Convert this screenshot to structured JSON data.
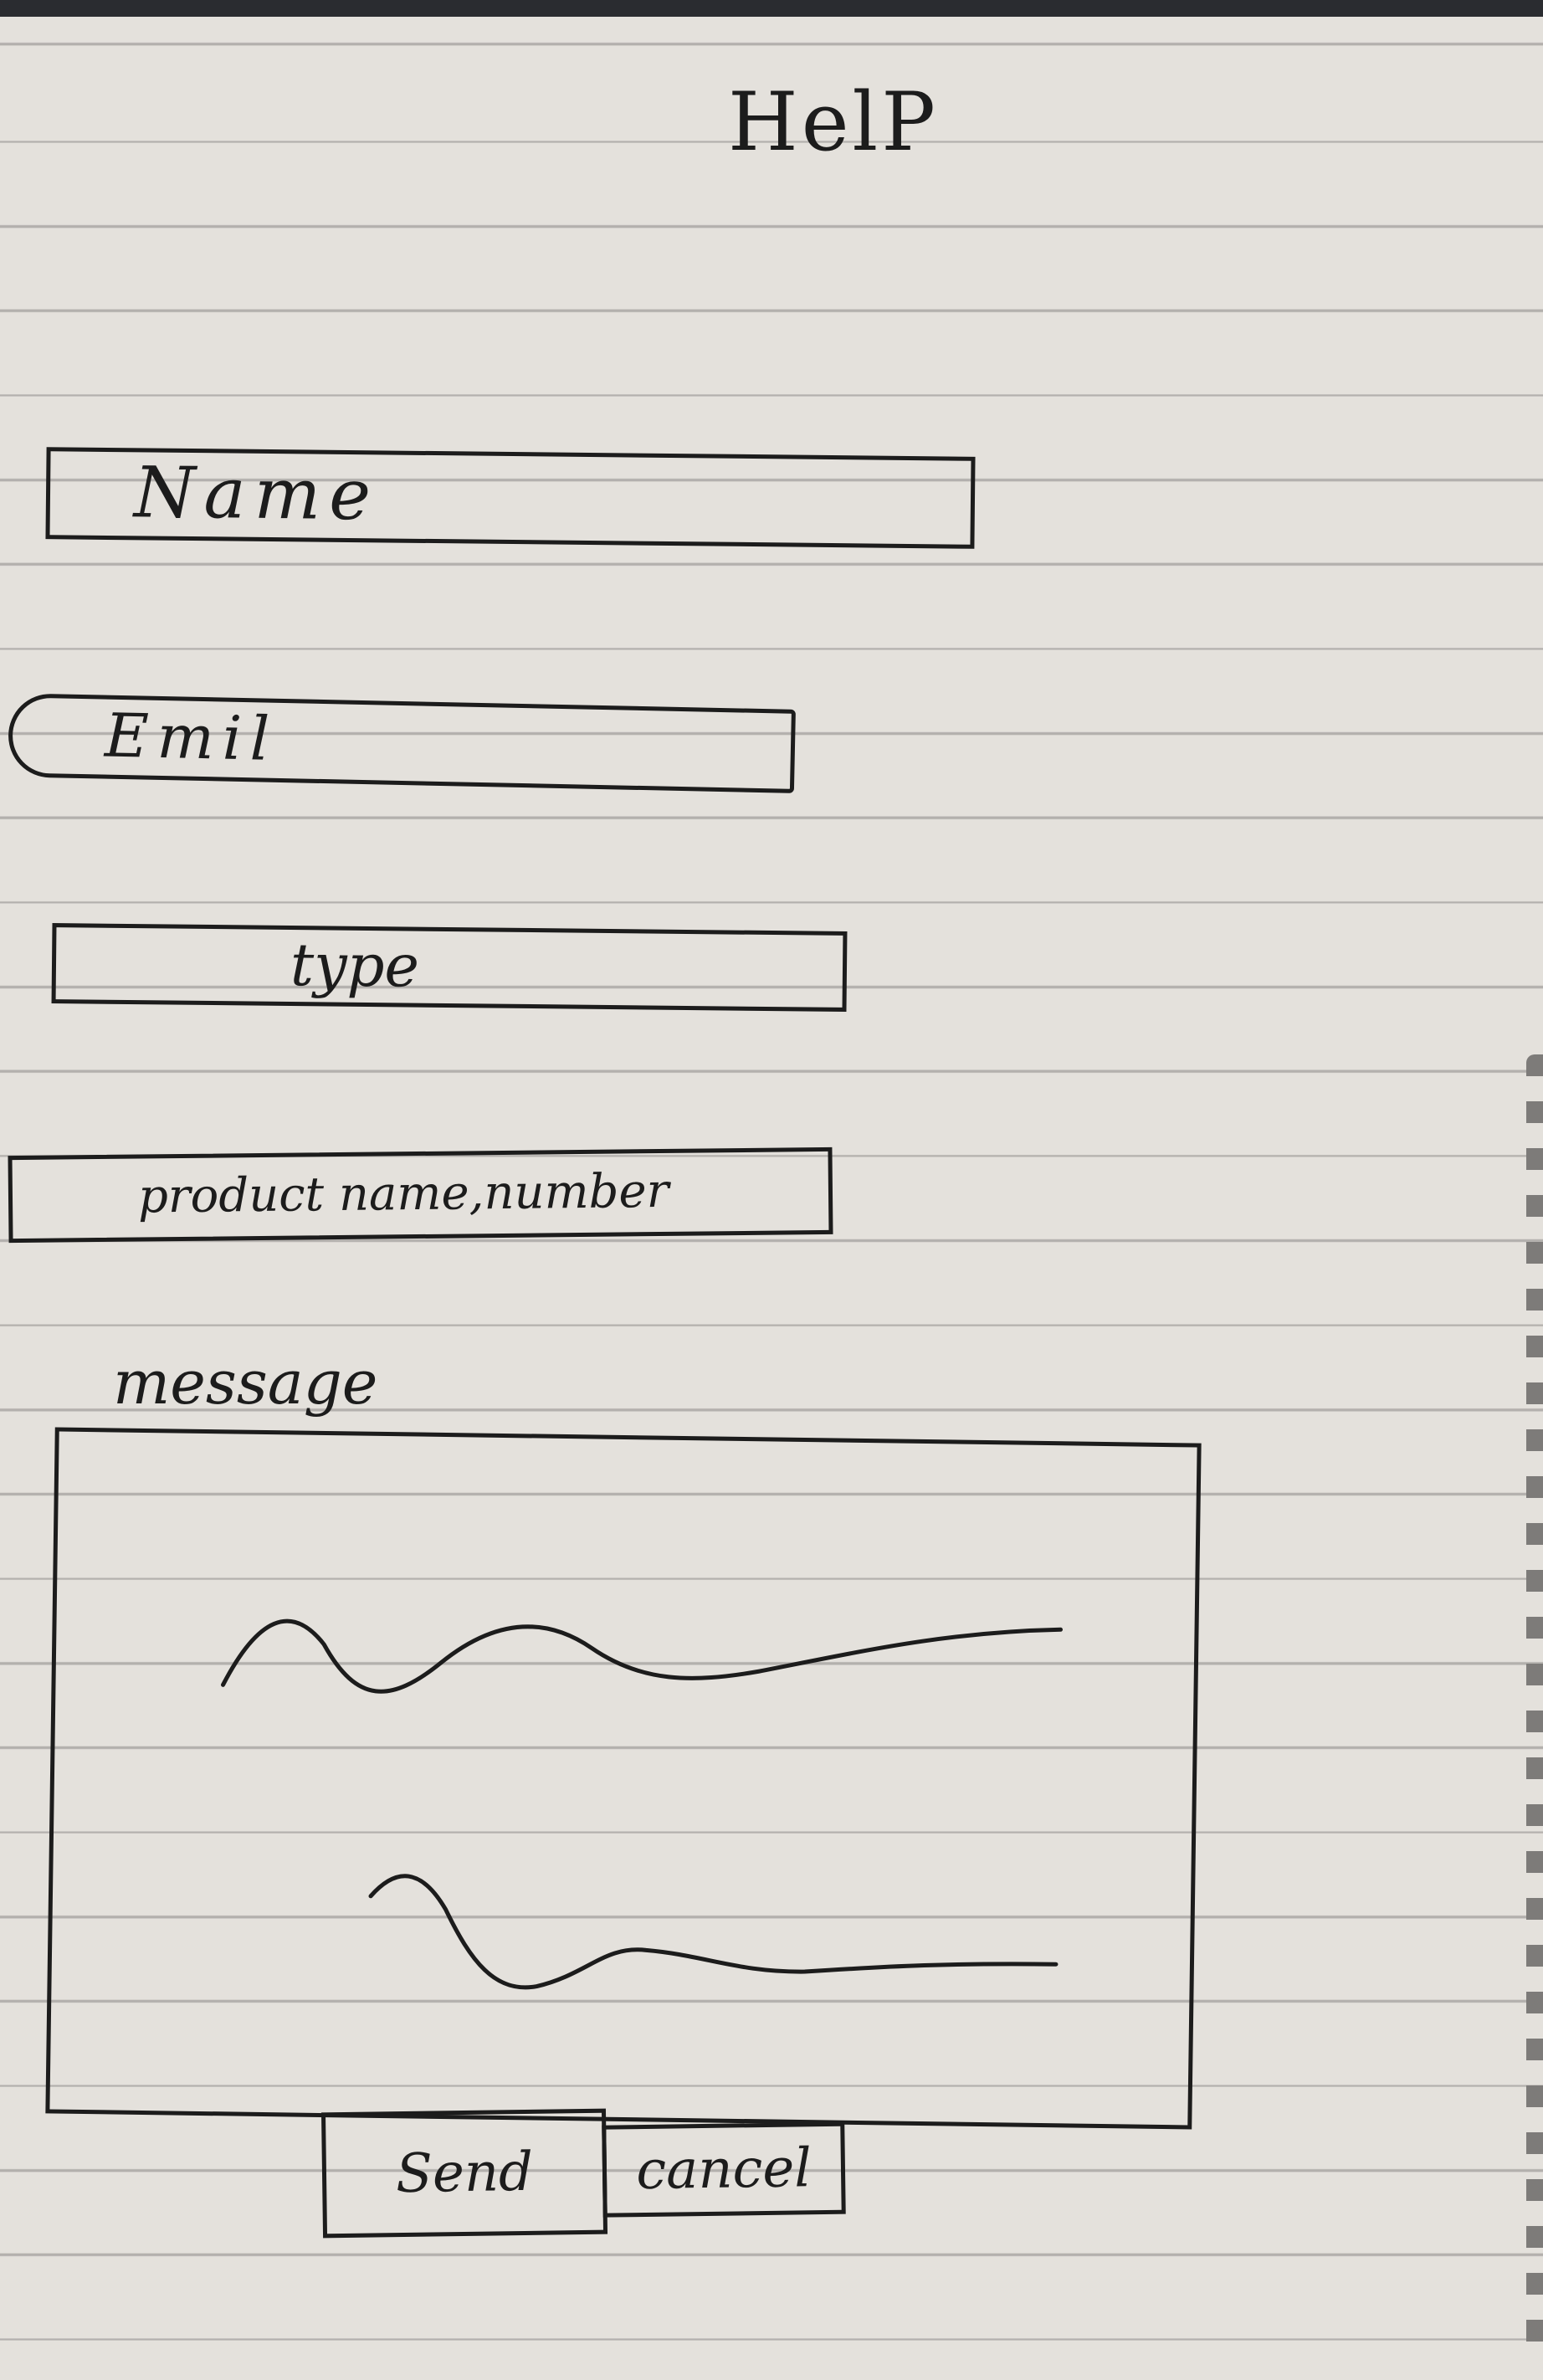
{
  "header": {
    "title": "HelP"
  },
  "form": {
    "name_placeholder": "Name",
    "email_placeholder": "Emil",
    "type_placeholder": "type",
    "product_placeholder": "product name,number",
    "message_label": "message"
  },
  "actions": {
    "send_label": "Send",
    "cancel_label": "cancel"
  }
}
